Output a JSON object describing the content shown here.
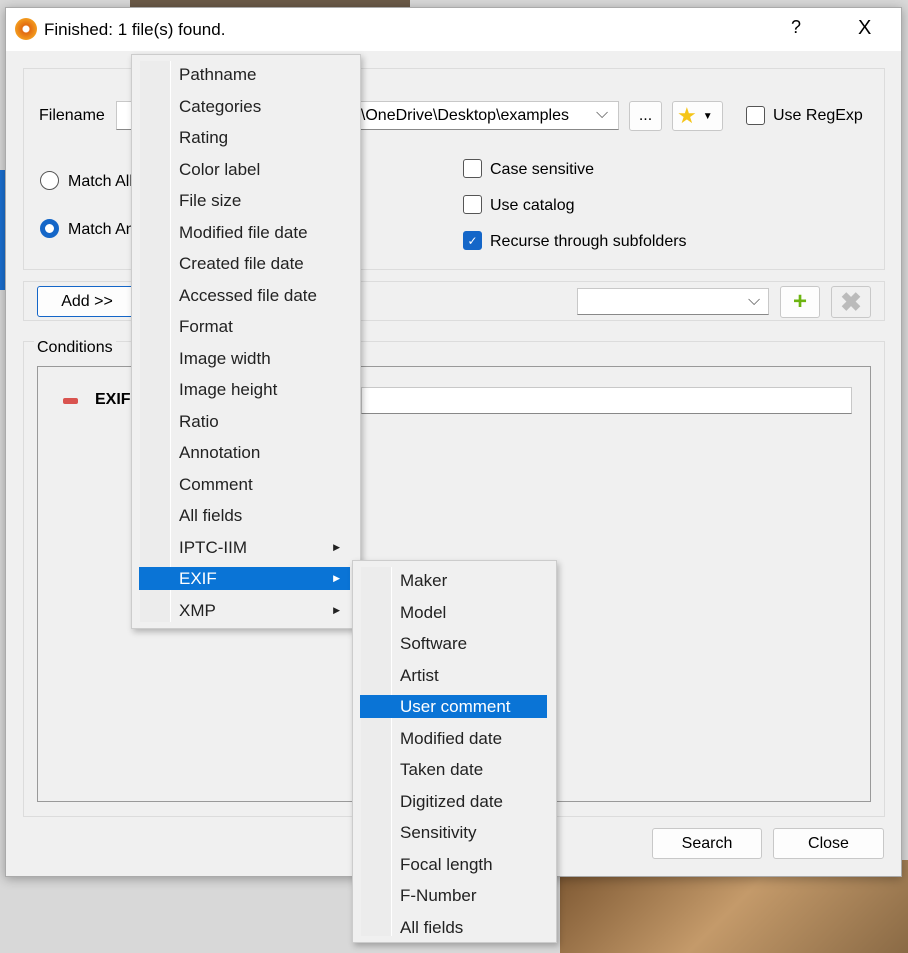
{
  "title": "Finished: 1 file(s) found.",
  "help_label": "?",
  "close_label": "X",
  "filename_label": "Filename",
  "path_value": "a\\OneDrive\\Desktop\\examples",
  "browse_label": "...",
  "use_regexp": "Use RegExp",
  "match_all": "Match All",
  "match_any": "Match Any",
  "case_sensitive": "Case sensitive",
  "use_catalog": "Use catalog",
  "recurse": "Recurse through subfolders",
  "add_label": "Add >>",
  "conditions_label": "Conditions",
  "condition_field": "EXIF",
  "search_label": "Search",
  "close_button": "Close",
  "menu1": [
    "Pathname",
    "Categories",
    "Rating",
    "Color label",
    "File size",
    "Modified file date",
    "Created file date",
    "Accessed file date",
    "Format",
    "Image width",
    "Image height",
    "Ratio",
    "Annotation",
    "Comment",
    "All fields",
    "IPTC-IIM",
    "EXIF",
    "XMP"
  ],
  "menu2": [
    "Maker",
    "Model",
    "Software",
    "Artist",
    "User comment",
    "Modified date",
    "Taken date",
    "Digitized date",
    "Sensitivity",
    "Focal length",
    "F-Number",
    "All fields"
  ],
  "accent": "#0a74d6"
}
